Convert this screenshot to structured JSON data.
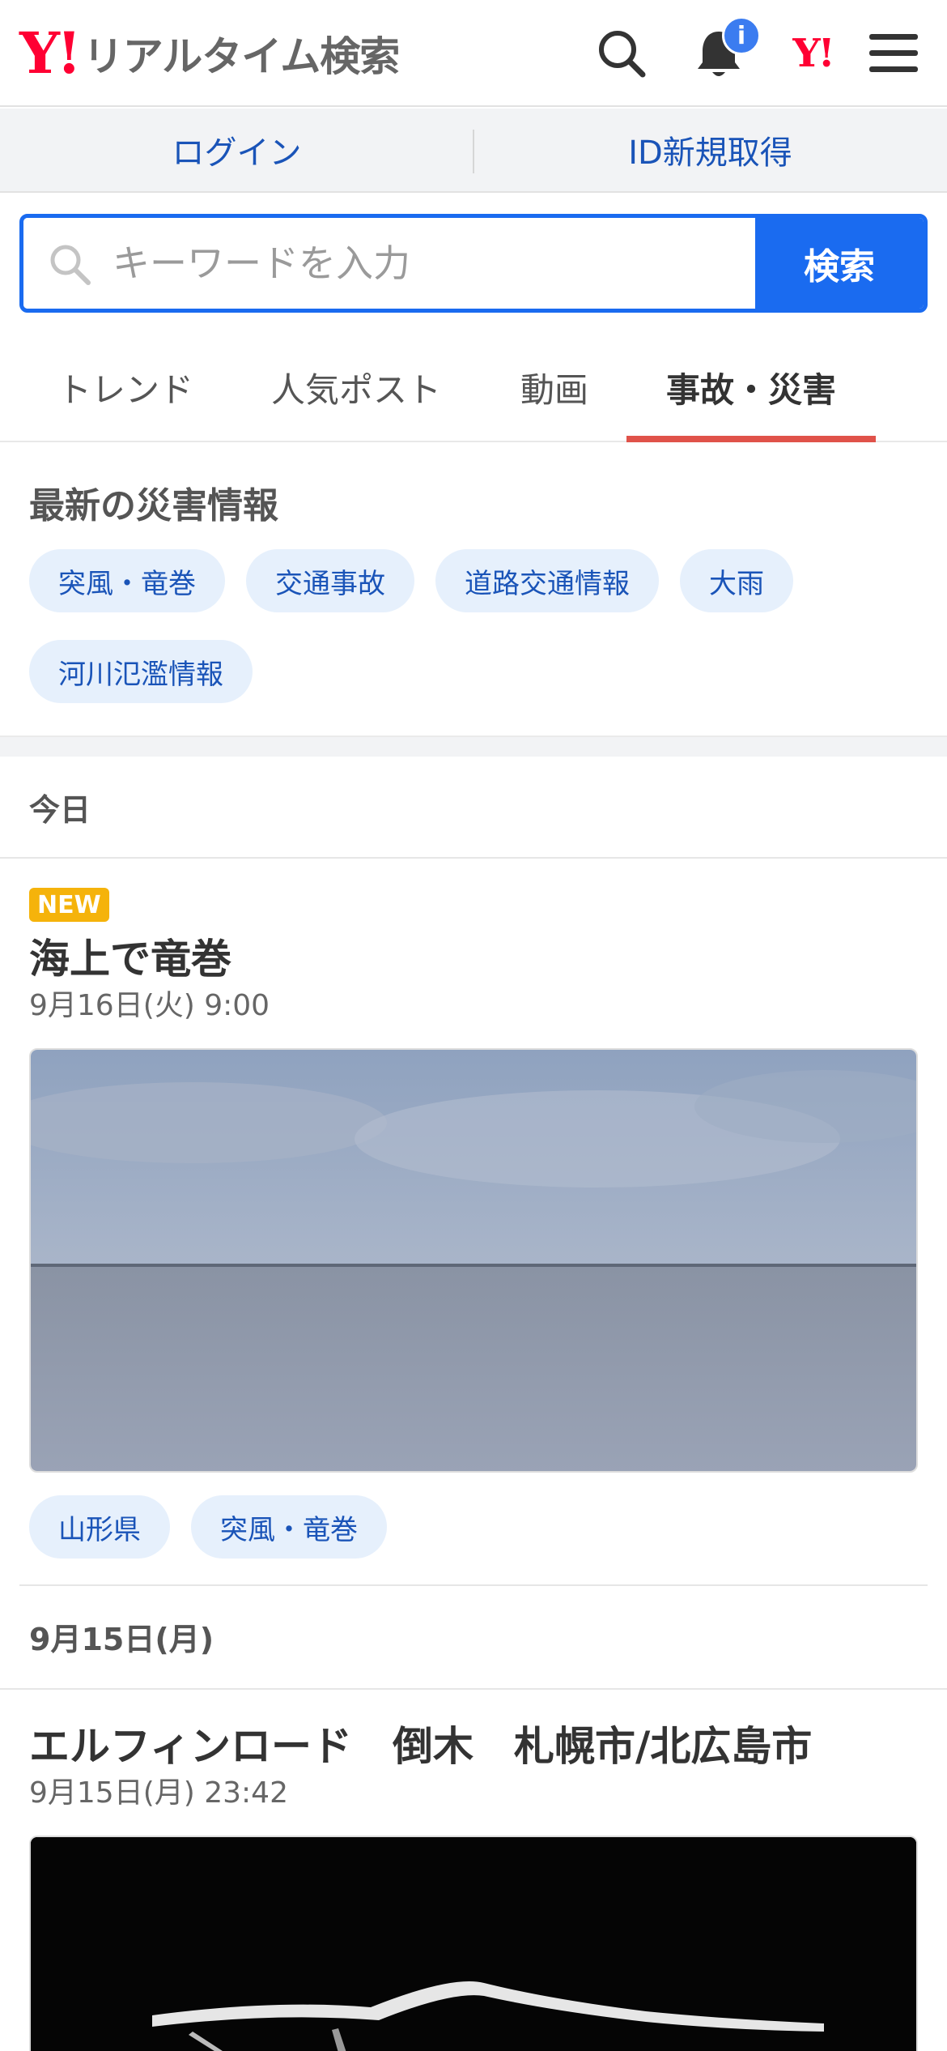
{
  "header": {
    "logo_mark": "Y!",
    "logo_text": "リアルタイム検索",
    "notification_badge": "i",
    "yahoo_mini": "Y!"
  },
  "login_bar": {
    "login": "ログイン",
    "register": "ID新規取得"
  },
  "search": {
    "placeholder": "キーワードを入力",
    "button": "検索"
  },
  "tabs": [
    {
      "label": "トレンド",
      "active": false
    },
    {
      "label": "人気ポスト",
      "active": false
    },
    {
      "label": "動画",
      "active": false
    },
    {
      "label": "事故・災害",
      "active": true
    }
  ],
  "disaster_info": {
    "title": "最新の災害情報",
    "chips": [
      "突風・竜巻",
      "交通事故",
      "道路交通情報",
      "大雨",
      "河川氾濫情報"
    ]
  },
  "sections": [
    {
      "heading": "今日",
      "items": [
        {
          "badge": "NEW",
          "title": "海上で竜巻",
          "date": "9月16日(火) 9:00",
          "tags": [
            "山形県",
            "突風・竜巻"
          ]
        }
      ]
    },
    {
      "heading": "9月15日(月)",
      "items": [
        {
          "title": "エルフィンロード　倒木　札幌市/北広島市",
          "date": "9月15日(月) 23:42"
        }
      ]
    }
  ],
  "colors": {
    "accent_blue": "#1a6bf0",
    "link_blue": "#1a54b8",
    "active_tab_underline": "#e0524a",
    "yahoo_red": "#ff0033",
    "new_badge": "#f5b30b"
  }
}
